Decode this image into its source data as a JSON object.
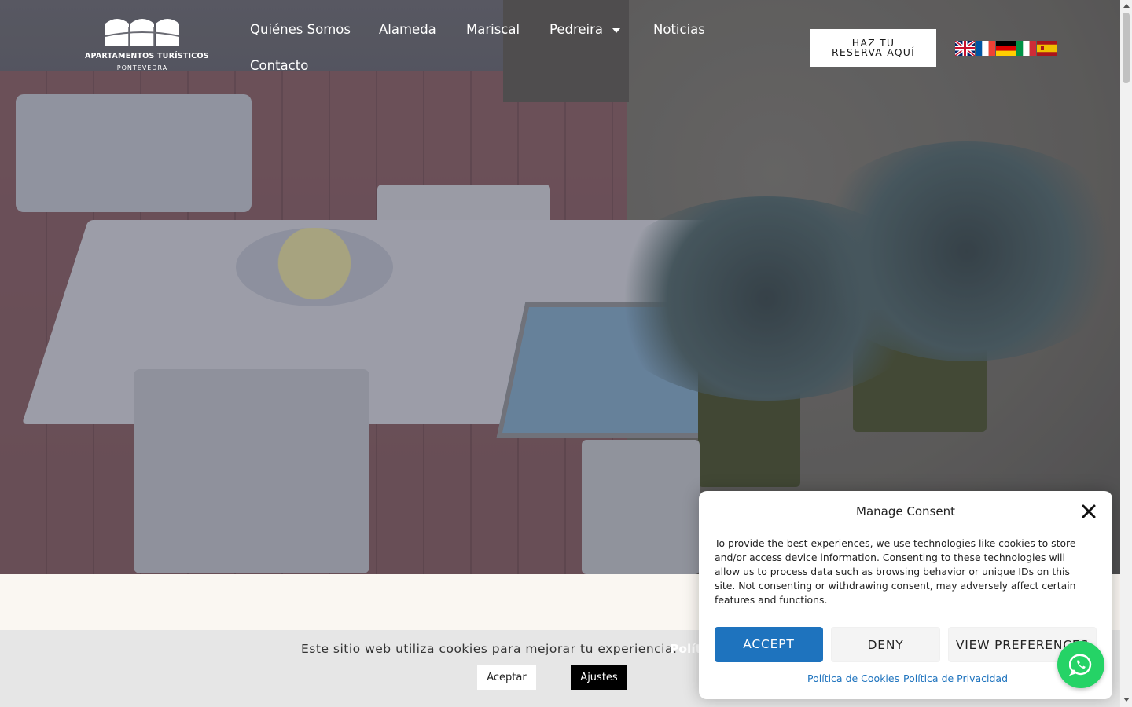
{
  "header": {
    "logo": {
      "line1": "APARTAMENTOS TURÍSTICOS",
      "line2": "PONTEVEDRA"
    },
    "nav": [
      {
        "label": "Quiénes Somos"
      },
      {
        "label": "Alameda"
      },
      {
        "label": "Mariscal"
      },
      {
        "label": "Pedreira"
      },
      {
        "label": "Noticias"
      },
      {
        "label": "Contacto"
      }
    ],
    "reserve_line1": "HAZ TU",
    "reserve_line2": "RESERVA AQUÍ",
    "flags": [
      "uk-flag-icon",
      "france-flag-icon",
      "germany-flag-icon",
      "italy-flag-icon",
      "spain-flag-icon"
    ]
  },
  "cookie_bar": {
    "message": "Este sitio web utiliza cookies para mejorar tu experiencia.",
    "policy_link": "Polít",
    "accept_label": "Aceptar",
    "settings_label": "Ajustes"
  },
  "consent": {
    "title": "Manage Consent",
    "body": "To provide the best experiences, we use technologies like cookies to store and/or access device information. Consenting to these technologies will allow us to process data such as browsing behavior or unique IDs on this site. Not consenting or withdrawing consent, may adversely affect certain features and functions.",
    "accept_label": "ACCEPT",
    "deny_label": "DENY",
    "preferences_label": "VIEW PREFERENCES",
    "cookie_policy_link": "Política de Cookies",
    "privacy_policy_link": "Política de Privacidad"
  },
  "colors": {
    "accent": "#1e73be",
    "whatsapp": "#25d366"
  }
}
